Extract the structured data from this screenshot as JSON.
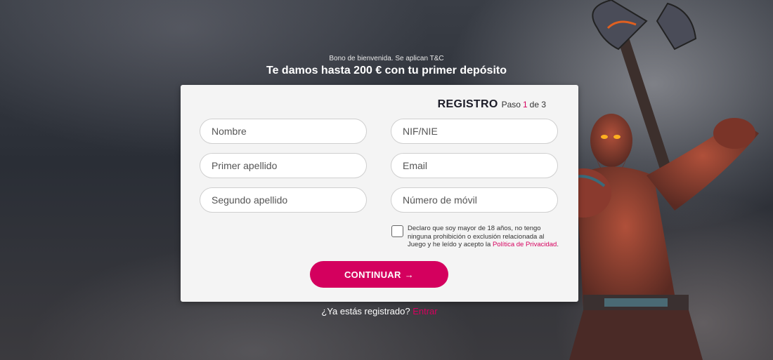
{
  "promo": {
    "disclaimer": "Bono de bienvenida. Se aplican T&C",
    "headline": "Te damos hasta 200 € con tu primer depósito"
  },
  "form": {
    "title": "REGISTRO",
    "step_label": "Paso",
    "step_current": "1",
    "step_of": "de 3",
    "fields": {
      "first_name": "Nombre",
      "nif": "NIF/NIE",
      "last_name_1": "Primer apellido",
      "email": "Email",
      "last_name_2": "Segundo apellido",
      "mobile": "Número de móvil"
    },
    "consent_text": "Declaro que soy mayor de 18 años, no tengo ninguna prohibición o exclusión relacionada al Juego y he leído y acepto la",
    "privacy_link": "Política de Privacidad",
    "continue_label": "CONTINUAR",
    "continue_icon": "→"
  },
  "login": {
    "question": "¿Ya estás registrado?",
    "link": "Entrar"
  },
  "colors": {
    "accent": "#d4005e",
    "card": "#f4f4f4"
  }
}
